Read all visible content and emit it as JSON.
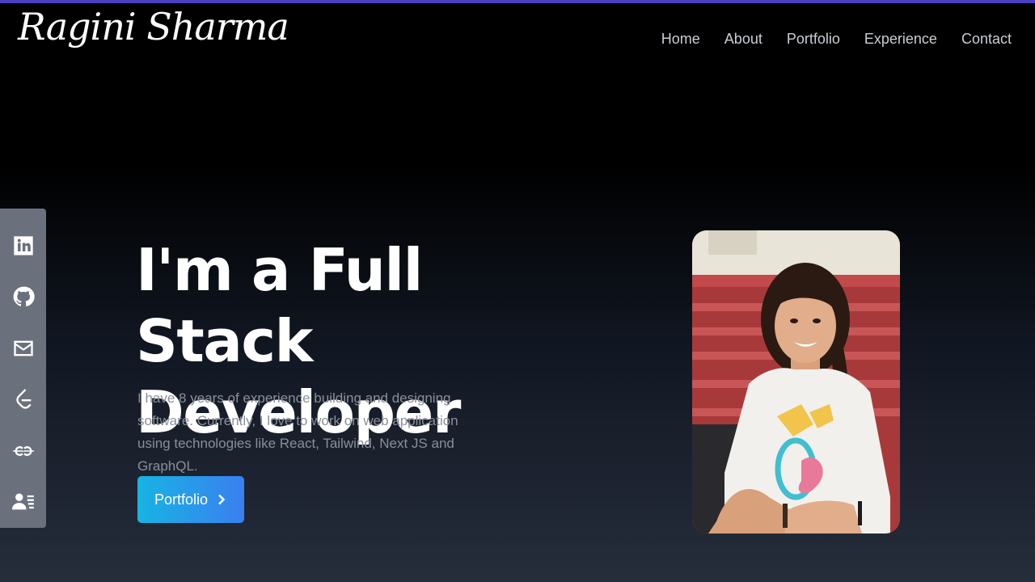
{
  "header": {
    "logo": "Ragini Sharma",
    "nav": [
      {
        "label": "Home"
      },
      {
        "label": "About"
      },
      {
        "label": "Portfolio"
      },
      {
        "label": "Experience"
      },
      {
        "label": "Contact"
      }
    ]
  },
  "social": [
    {
      "icon": "linkedin-icon"
    },
    {
      "icon": "github-icon"
    },
    {
      "icon": "mail-icon"
    },
    {
      "icon": "leetcode-icon"
    },
    {
      "icon": "geeksforgeeks-icon"
    },
    {
      "icon": "resume-icon"
    }
  ],
  "hero": {
    "headline_line1": "I'm a Full Stack",
    "headline_line2": "Developer",
    "description": "I have 8 years of experience building and designing software. Currently, I love to work on web application using technologies like React, Tailwind, Next JS and GraphQL.",
    "cta_label": "Portfolio"
  },
  "colors": {
    "accent_stripe": "#4a3fc2",
    "cta_gradient_start": "#17b4e3",
    "cta_gradient_end": "#3a7ff0",
    "social_bar": "#6b717c"
  }
}
